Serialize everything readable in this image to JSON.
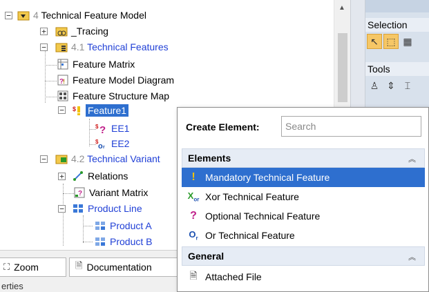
{
  "tree": {
    "root": {
      "num": "4",
      "label": "Technical Feature Model"
    },
    "tracing": {
      "label": "_Tracing"
    },
    "features_group": {
      "num": "4.1",
      "label": "Technical Features"
    },
    "feature_matrix": {
      "label": "Feature Matrix"
    },
    "feature_model_diagram": {
      "label": "Feature Model Diagram"
    },
    "feature_structure_map": {
      "label": "Feature Structure Map"
    },
    "feature1": {
      "label": "Feature1"
    },
    "ee1": {
      "label": "EE1"
    },
    "ee2": {
      "label": "EE2"
    },
    "variants_group": {
      "num": "4.2",
      "label": "Technical Variant"
    },
    "relations": {
      "label": "Relations"
    },
    "variant_matrix": {
      "label": "Variant Matrix"
    },
    "product_line": {
      "label": "Product Line"
    },
    "product_a": {
      "label": "Product A"
    },
    "product_b": {
      "label": "Product B"
    }
  },
  "toolbox": {
    "selection_label": "Selection",
    "tools_label": "Tools"
  },
  "bottom_tabs": {
    "zoom_label": "Zoom",
    "documentation_label": "Documentation",
    "properties_label": "erties"
  },
  "popup": {
    "create_label": "Create Element:",
    "search_placeholder": "Search",
    "elements_section": "Elements",
    "elements": [
      {
        "label": "Mandatory Technical Feature",
        "icon": "exclamation-icon",
        "selected": true
      },
      {
        "label": "Xor Technical Feature",
        "icon": "xor-icon"
      },
      {
        "label": "Optional Technical Feature",
        "icon": "question-icon"
      },
      {
        "label": "Or Technical Feature",
        "icon": "or-icon"
      }
    ],
    "general_section": "General",
    "general": [
      {
        "label": "Attached File",
        "icon": "file-icon"
      }
    ]
  },
  "colors": {
    "selection": "#2e6fcf",
    "link_blue": "#1f3fd6",
    "mandatory_yellow": "#f2c200",
    "xor_green": "#2a9a2a",
    "optional_magenta": "#c0208a",
    "or_blue": "#1a4fb0"
  }
}
